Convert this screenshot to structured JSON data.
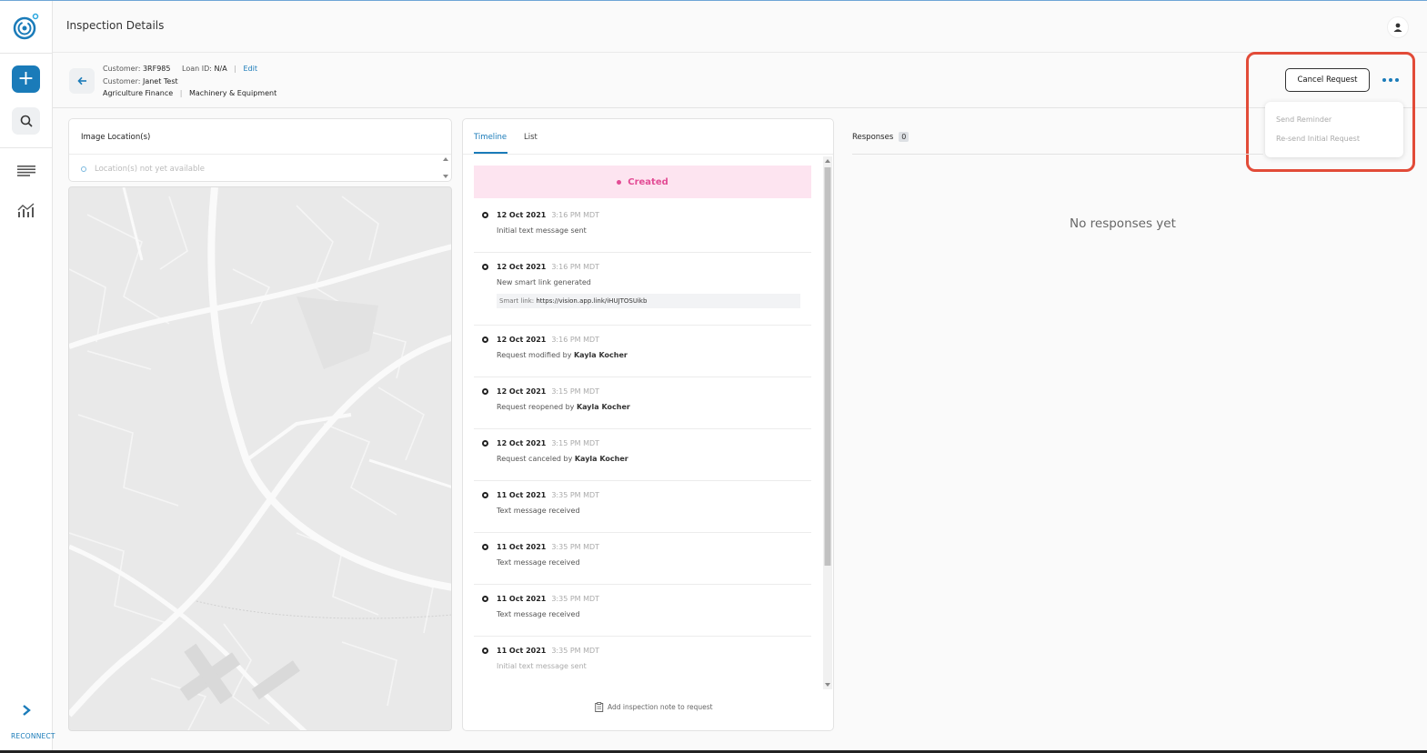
{
  "header": {
    "title": "Inspection Details"
  },
  "sidebar": {
    "reconnect_label": "RECONNECT",
    "add_symbol": "+"
  },
  "info": {
    "customer_label": "Customer:",
    "customer_id": "3RF985",
    "loan_label": "Loan ID:",
    "loan_id": "N/A",
    "sep": "|",
    "edit_label": "Edit",
    "customer_label_2": "Customer:",
    "customer_name": "Janet Test",
    "category": "Agriculture Finance",
    "subcategory": "Machinery & Equipment"
  },
  "actions": {
    "cancel_label": "Cancel Request",
    "menu": {
      "send_reminder": "Send Reminder",
      "resend_initial": "Re-send Initial Request"
    }
  },
  "locations": {
    "title": "Image Location(s)",
    "empty_text": "Location(s) not yet available"
  },
  "timeline": {
    "tabs": {
      "timeline": "Timeline",
      "list": "List"
    },
    "status": "Created",
    "events": [
      {
        "date": "12 Oct 2021",
        "time": "3:16 PM MDT",
        "text": "Initial text message sent"
      },
      {
        "date": "12 Oct 2021",
        "time": "3:16 PM MDT",
        "text": "New smart link generated",
        "link_label": "Smart link:",
        "link_url": "https://vision.app.link/iHUJTOSUikb"
      },
      {
        "date": "12 Oct 2021",
        "time": "3:16 PM MDT",
        "text": "Request modified by",
        "actor": "Kayla Kocher"
      },
      {
        "date": "12 Oct 2021",
        "time": "3:15 PM MDT",
        "text": "Request reopened by",
        "actor": "Kayla Kocher"
      },
      {
        "date": "12 Oct 2021",
        "time": "3:15 PM MDT",
        "text": "Request canceled by",
        "actor": "Kayla Kocher"
      },
      {
        "date": "11 Oct 2021",
        "time": "3:35 PM MDT",
        "text": "Text message received"
      },
      {
        "date": "11 Oct 2021",
        "time": "3:35 PM MDT",
        "text": "Text message received"
      },
      {
        "date": "11 Oct 2021",
        "time": "3:35 PM MDT",
        "text": "Text message received"
      },
      {
        "date": "11 Oct 2021",
        "time": "3:35 PM MDT",
        "text": "Initial text message sent"
      }
    ],
    "add_note_label": "Add inspection note to request"
  },
  "responses": {
    "title": "Responses",
    "count": "0",
    "empty_text": "No responses yet"
  },
  "colors": {
    "accent": "#1a7bb9",
    "created_bg": "#fde4f0",
    "created_text": "#e34c95",
    "highlight": "#e24b38"
  }
}
